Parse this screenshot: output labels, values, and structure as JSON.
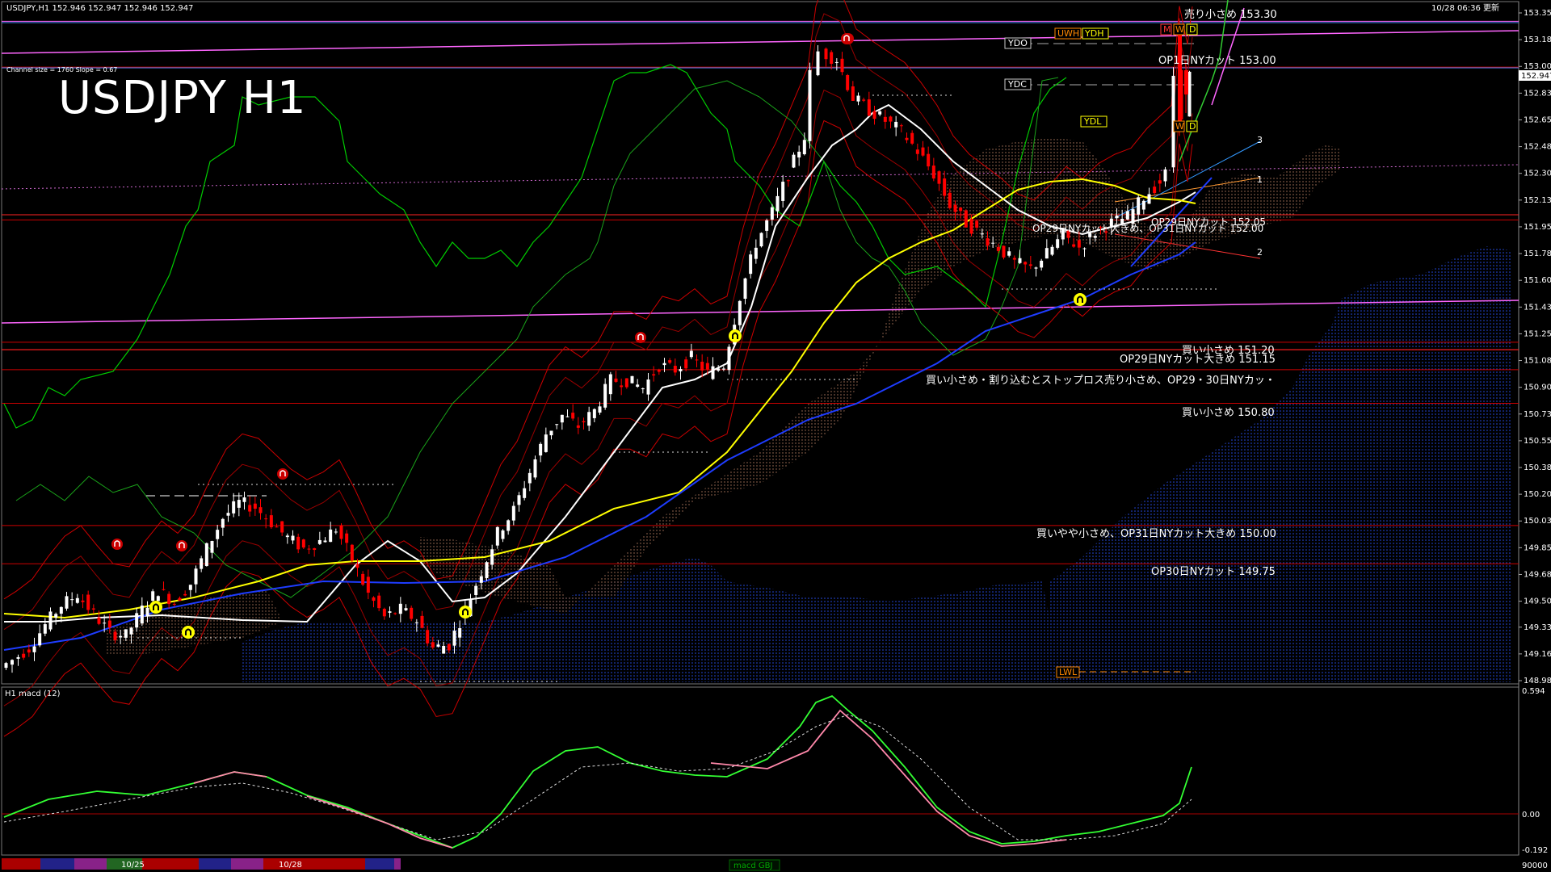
{
  "header": {
    "symbol_info": "USDJPY,H1  152.946 152.947 152.946 152.947",
    "datetime": "10/28 06:36 更新",
    "channel_info": "Channel size = 1760 Slope = 0.67",
    "big_title": "USDJPY H1"
  },
  "price_axis": {
    "ticks": [
      "153.355",
      "153.180",
      "153.005",
      "152.830",
      "152.655",
      "152.480",
      "152.305",
      "152.130",
      "151.955",
      "151.780",
      "151.605",
      "151.430",
      "151.255",
      "151.080",
      "150.905",
      "150.730",
      "150.555",
      "150.380",
      "150.205",
      "150.030",
      "149.855",
      "149.680",
      "149.505",
      "149.335",
      "149.160",
      "148.985"
    ],
    "current_price": "152.947"
  },
  "levels": [
    {
      "label": "売り小さめ 153.30",
      "price": 153.3,
      "color": "#ff66ff"
    },
    {
      "label": "OP1日NYカット 153.00",
      "price": 153.0,
      "color": "#cc0000"
    },
    {
      "label": "OP29日NYカット大きめ、OP31日NYカット 152.00",
      "price": 152.0,
      "color": "#cc0000"
    },
    {
      "label": "買い小さめ 151.20",
      "price": 151.2,
      "color": "#cc0000"
    },
    {
      "label": "OP29日NYカット大きめ 151.15",
      "price": 151.15,
      "color": "#cc0000"
    },
    {
      "label": "買い小さめ・割り込むとストップロス売り小さめ、OP29・30日NYカッ・",
      "price": 151.02,
      "color": "#cc0000"
    },
    {
      "label": "買い小さめ 150.80",
      "price": 150.8,
      "color": "#cc0000"
    },
    {
      "label": "買いやや小さめ、OP31日NYカット大きめ 150.00",
      "price": 150.0,
      "color": "#cc0000"
    },
    {
      "label": "OP30日NYカット 149.75",
      "price": 149.75,
      "color": "#cc0000"
    }
  ],
  "level_extra": {
    "label": "OP29日NYカット 152.05"
  },
  "markers": {
    "ydo": "YDO",
    "uwh": "UWH",
    "ydh": "YDH",
    "ydc": "YDC",
    "ydl": "YDL",
    "lwl": "LWL",
    "m": "M",
    "w_top": "W",
    "d_top": "D",
    "w_bot": "W",
    "d_bot": "D"
  },
  "channel_labels": [
    "1",
    "2",
    "3"
  ],
  "macd": {
    "title": "H1  macd (12)",
    "ticks": [
      "0.594",
      "0.00",
      "-0.192"
    ]
  },
  "time_axis": {
    "labels": [
      "10/25",
      "10/28"
    ],
    "volume": "90000"
  },
  "bottom_tab": {
    "label": "macd GBJ"
  },
  "colors": {
    "background": "#000000",
    "bull_candle": "#ffffff",
    "bear_candle": "#ff0000",
    "ma_white": "#ffffff",
    "ma_yellow": "#ffff00",
    "ma_blue": "#1e3cff",
    "bollinger": "#cc0000",
    "chikou": "#00cc00",
    "kumo_bull": "#1133aa",
    "kumo_bear": "#cc8866",
    "macd_up": "#33ff33",
    "macd_down": "#ff88aa"
  }
}
